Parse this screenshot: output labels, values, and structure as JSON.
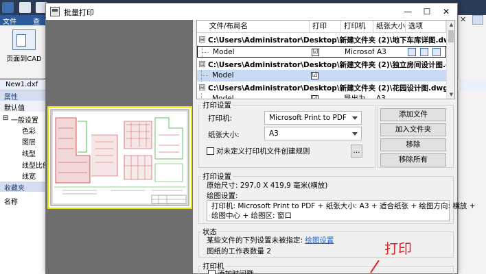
{
  "background_app": {
    "ribbon_tab_file": "文件",
    "ribbon_tab_2": "查",
    "page_button_label": "页面到CAD",
    "doc_tab": "New1.dxf",
    "properties_header": "属性",
    "default_value_label": "默认值",
    "props": [
      {
        "label": "一般设置",
        "expander": "⊟"
      },
      {
        "label": "色彩"
      },
      {
        "label": "图层"
      },
      {
        "label": "线型"
      },
      {
        "label": "线型比例"
      },
      {
        "label": "线宽"
      }
    ],
    "favorites_header": "收藏夹",
    "name_label": "名称"
  },
  "dialog": {
    "title": "批量打印",
    "minimize": "—",
    "maximize": "☐",
    "close": "✕"
  },
  "file_list": {
    "columns": [
      "文件/布局名",
      "打印",
      "打印机",
      "纸张大小",
      "选项"
    ],
    "groups": [
      {
        "path": "C:\\Users\\Administrator\\Desktop\\新建文件夹 (2)\\地下车库详图.dwg",
        "rows": [
          {
            "layout": "Model",
            "print": "☑",
            "printer": "Microsoft",
            "paper": "A3"
          }
        ]
      },
      {
        "path": "C:\\Users\\Administrator\\Desktop\\新建文件夹 (2)\\独立房间设计图.dwg",
        "rows": [
          {
            "layout": "Model",
            "print": "☑",
            "printer": "",
            "paper": ""
          }
        ]
      },
      {
        "path": "C:\\Users\\Administrator\\Desktop\\新建文件夹 (2)\\花园设计图.dwg",
        "rows": [
          {
            "layout": "Model",
            "print": "☑",
            "printer": "导出为",
            "paper": "A3"
          }
        ]
      }
    ],
    "expander": "⊟"
  },
  "print_settings_top": {
    "title": "打印设置",
    "printer_label": "打印机:",
    "printer_value": "Microsoft Print to PDF",
    "paper_label": "纸张大小:",
    "paper_value": "A3",
    "custom_rules_label": "对未定义打印机文件创建规则",
    "ellipsis": "...",
    "add_file": "添加文件",
    "add_folder": "加入文件夹",
    "remove": "移除",
    "remove_all": "移除所有"
  },
  "print_settings_info": {
    "title": "打印设置",
    "original_size": "原始尺寸: 297,0 X 419,9 毫米(横放)",
    "drawing_settings_label": "绘图设置:",
    "summary_line1": "打印机: Microsoft Print to PDF + 纸张大小: A3 + 适合纸张 + 绘图方向: 横放 +",
    "summary_line2": "绘图中心 + 绘图区: 窗口"
  },
  "status": {
    "title": "状态",
    "line1_prefix": "某些文件的下列设置未被指定: ",
    "line1_link": "绘图设置",
    "line2": "图纸的工作表数量 2"
  },
  "printer_section": {
    "title": "打印机",
    "add_timestamp": "添加时间戳"
  },
  "annotation": {
    "text": "打印",
    "color": "#e02020"
  }
}
